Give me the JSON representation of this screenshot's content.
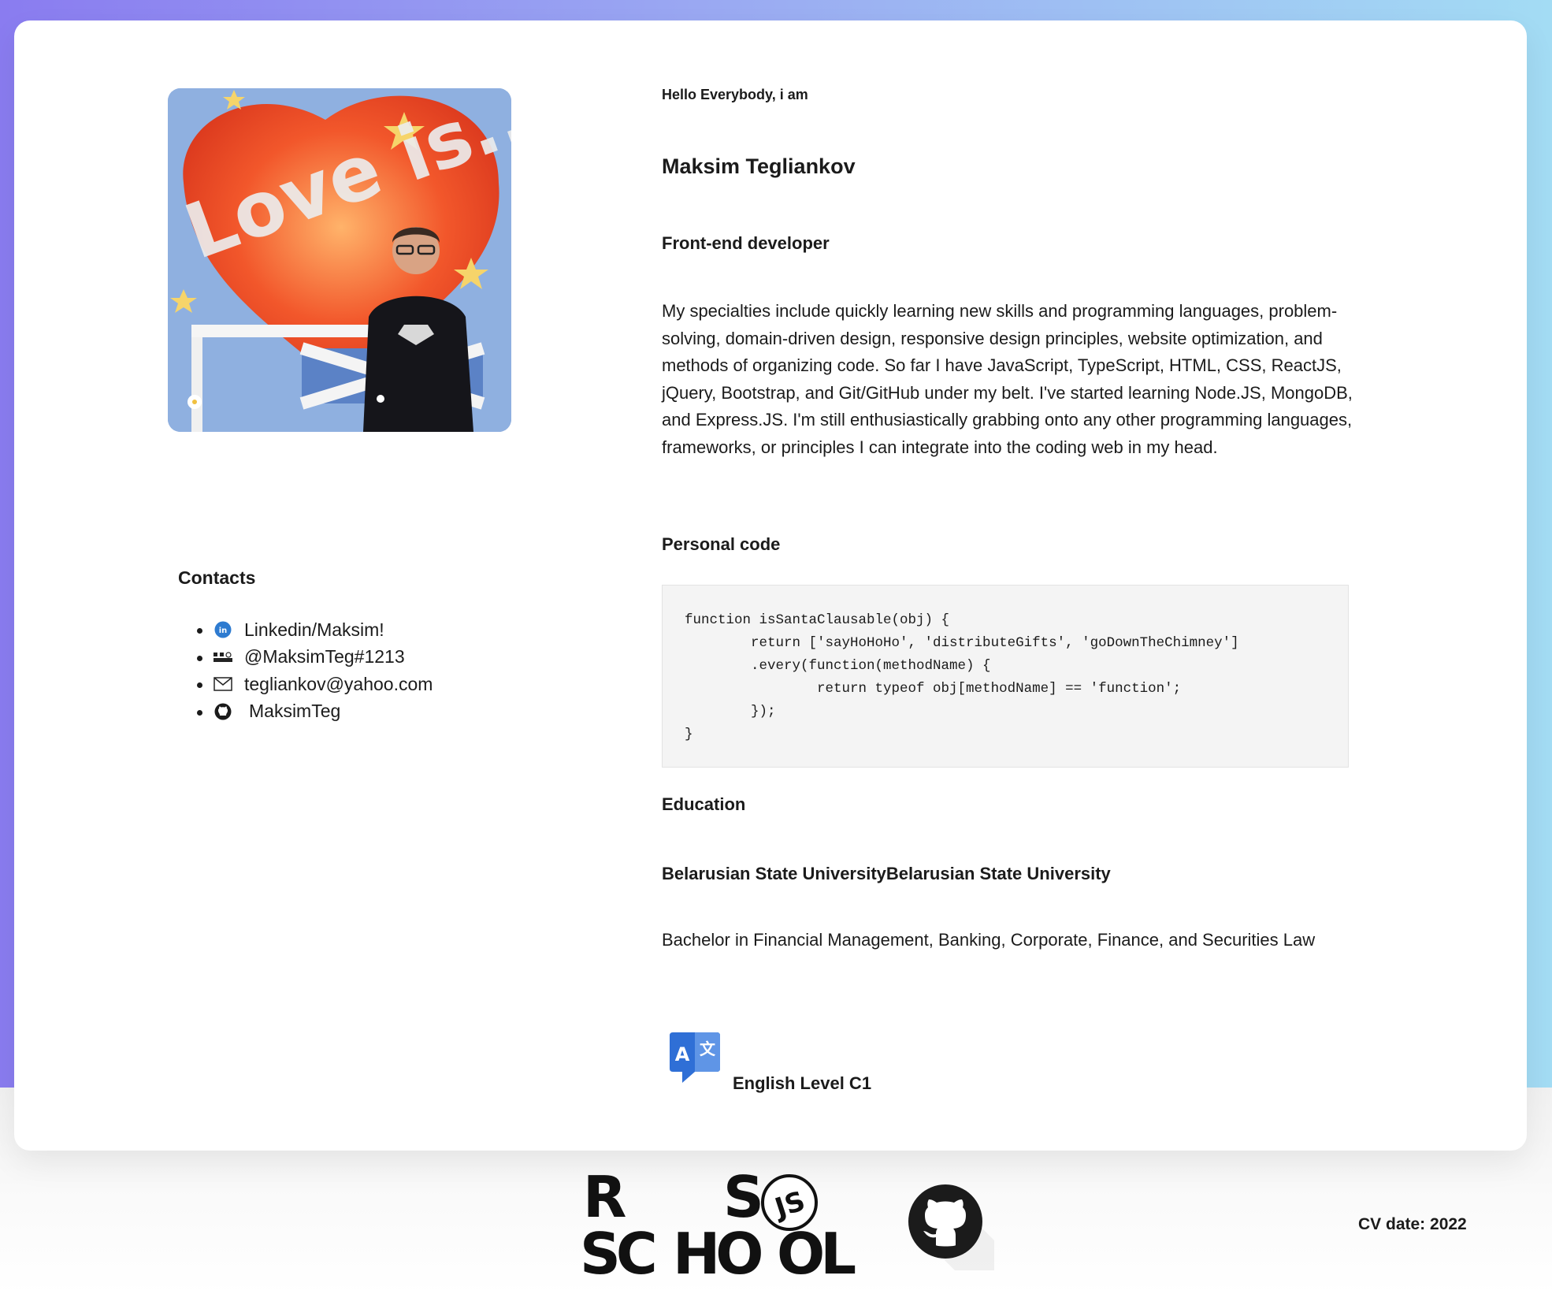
{
  "profile": {
    "greeting": "Hello Everybody, i am",
    "name": "Maksim Tegliankov",
    "role": "Front-end developer",
    "photo_text": "Love is...",
    "about": "My specialties include quickly learning new skills and programming languages, problem-solving, domain-driven design, responsive design principles, website optimization, and methods of organizing code. So far I have JavaScript, TypeScript, HTML, CSS, ReactJS, jQuery, Bootstrap, and Git/GitHub under my belt. I've started learning Node.JS, MongoDB, and Express.JS. I'm still enthusiastically grabbing onto any other programming languages, frameworks, or principles I can integrate into the coding web in my head."
  },
  "contacts": {
    "title": "Contacts",
    "items": [
      {
        "icon": "linkedin-icon",
        "label": "Linkedin/Maksim!"
      },
      {
        "icon": "rs-school-icon",
        "label": "@MaksimTeg#1213"
      },
      {
        "icon": "envelope-icon",
        "label": "tegliankov@yahoo.com"
      },
      {
        "icon": "github-icon",
        "label": "MaksimTeg"
      }
    ]
  },
  "code": {
    "title": "Personal code",
    "snippet": "function isSantaClausable(obj) {\n        return ['sayHoHoHo', 'distributeGifts', 'goDownTheChimney']\n        .every(function(methodName) {\n                return typeof obj[methodName] == 'function';\n        });\n}"
  },
  "education": {
    "title": "Education",
    "university": "Belarusian State UniversityBelarusian State University",
    "degree": "Bachelor in Financial Management, Banking, Corporate, Finance, and Securities Law"
  },
  "language": {
    "icon": "translate-icon",
    "label": "English Level C1"
  },
  "footer": {
    "rs_logo": {
      "r": "R",
      "s": "S",
      "sc": "SC",
      "ho": "HO",
      "ol": "OL",
      "js": "JS"
    },
    "github_icon": "github-logo-icon",
    "cv_date": "CV date: 2022"
  },
  "colors": {
    "gradient_left": "#8a7cf0",
    "gradient_right": "#a3dcf4",
    "linkedin": "#2e7bd0",
    "translate_blue": "#2f6fd6"
  }
}
